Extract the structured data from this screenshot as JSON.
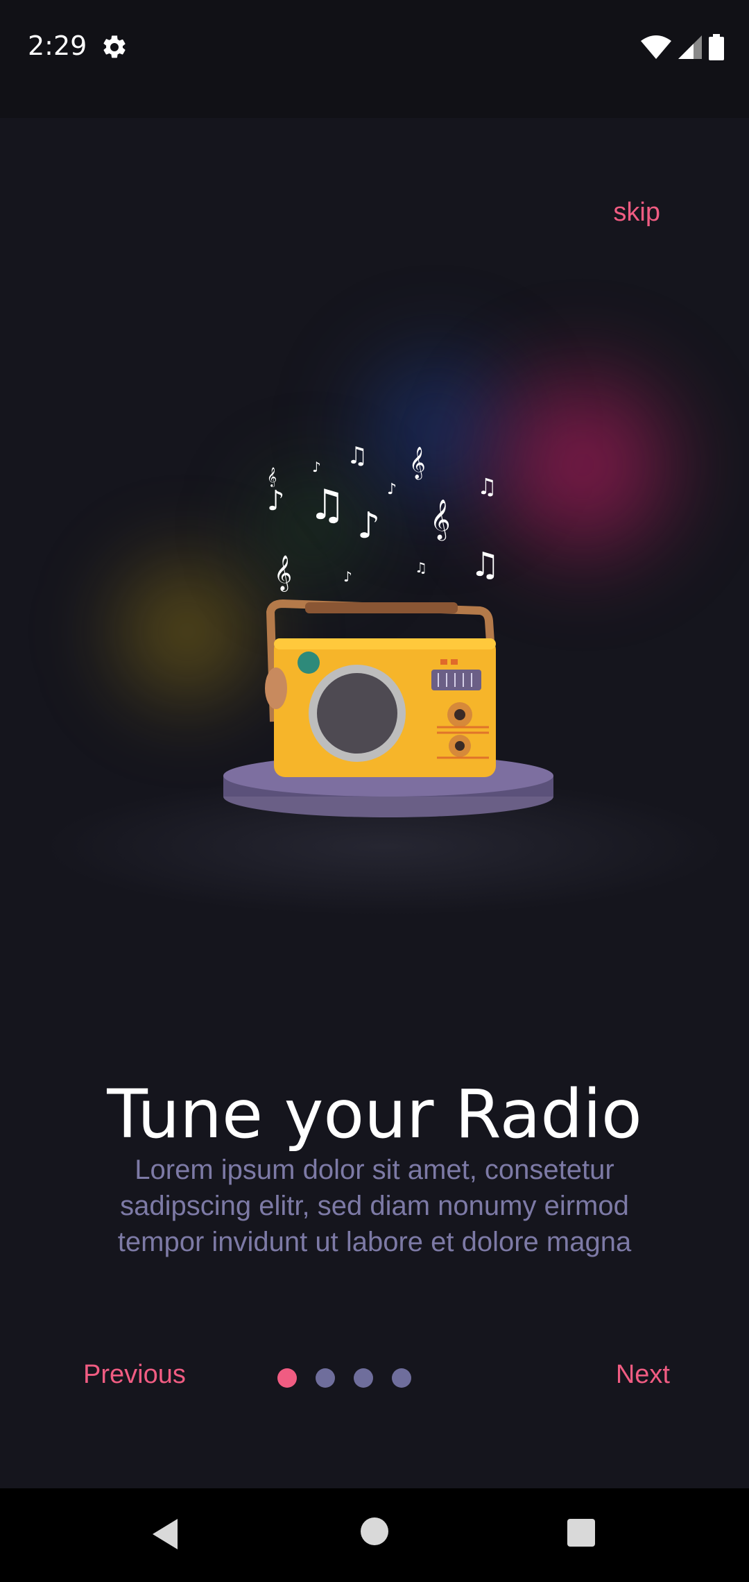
{
  "status_bar": {
    "time": "2:29",
    "icons": [
      "settings-icon",
      "wifi-icon",
      "cell-signal-icon",
      "battery-icon"
    ]
  },
  "onboarding": {
    "skip_label": "skip",
    "title": "Tune your Radio",
    "description": "Lorem ipsum dolor sit amet, consetetur sadipscing elitr, sed diam nonumy eirmod tempor invidunt ut labore et dolore magna",
    "previous_label": "Previous",
    "next_label": "Next",
    "page_count": 4,
    "current_page": 1
  },
  "colors": {
    "accent": "#f05c82",
    "dot_inactive": "#6f6e9c",
    "background": "#15151d",
    "description_text": "#7d7aa6"
  },
  "illustration": "radio-with-music-notes-illustration",
  "nav_bar": {
    "icons": [
      "back-icon",
      "home-icon",
      "recents-icon"
    ]
  }
}
